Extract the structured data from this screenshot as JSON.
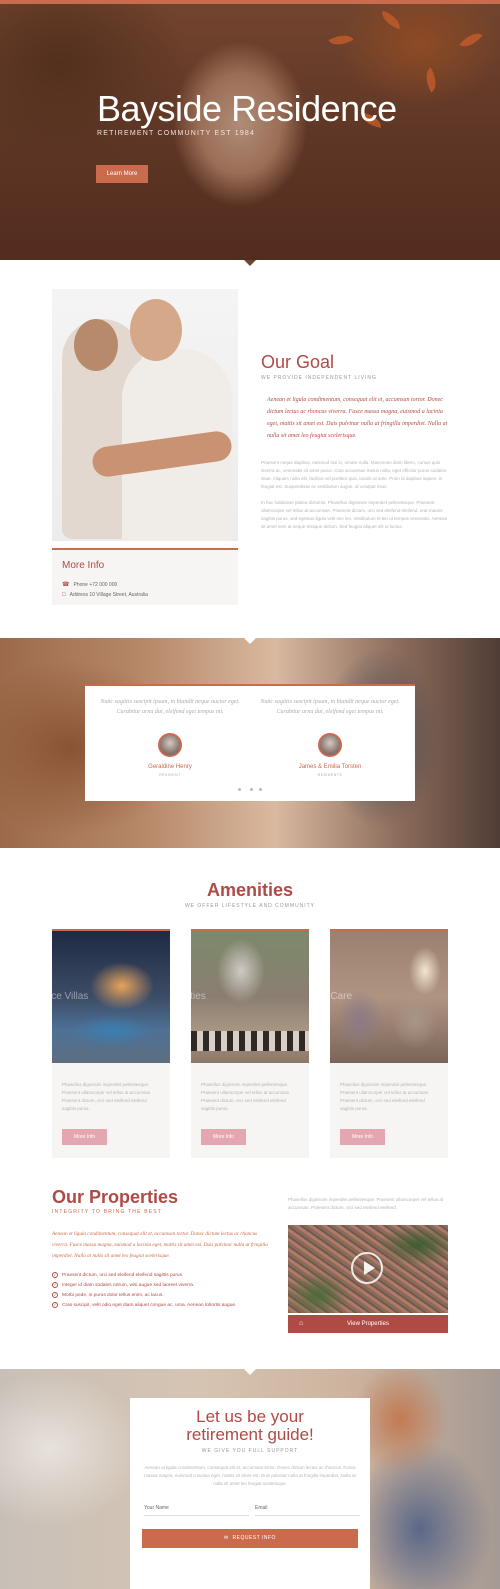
{
  "hero": {
    "title": "Bayside Residence",
    "tagline": "RETIREMENT COMMUNITY EST 1984",
    "button": "Learn More"
  },
  "goal": {
    "title": "Our Goal",
    "subtitle": "WE PROVIDE INDEPENDENT LIVING",
    "quote": "Aenean et ligula condimentum, consequat elit et, accumsan tortor. Donec dictum lectus ac rhoncus viverra. Fusce massa magna, euismod a lacinia eget, mattis sit amet est. Duis pulvinar nulla at fringilla imperdiet. Nulla at nulla sit amet leo feugiat scelerisque.",
    "paragraph1": "Praesent neque dapibus, euismod nisi in, ornare nulla. Maecenas diam libero, cursus quis viverra ac, venenatis sit amet purus. Cras accumsan metus nulla, eget efficitur purus sodales vitae. Aliquam nulla elit, facilisis vel porttitor quis, iaculis ut ante. Proin id dapibus sapien, in feugiat est. Suspendisse ac vestibulum augue, id volutpat risus.",
    "paragraph2": "In hac habitasse platea dictumst. Phasellus dignissim imperdiet pellentesque. Praesent ullamcorper vel tellus at accumsan. Praesent dictum, orci sed eleifend eleifend, erat mauris sagittis purus, sed egestas ligula velit nec leo. Vestibulum et leo ut tempus venenatis. Aenean sit amet sem at neque tristique dictum. Sed feugiat aliquet elit ut luctus."
  },
  "info": {
    "title": "More Info",
    "phone": "Phone +72 000 000",
    "address": "Address 10 Village Street, Australia"
  },
  "testimonials": [
    {
      "quote": "Nunc sagittis suscipit ipsum, in blandit neque auctor eget. Curabitur urna dui, eleifend eget tempus mi.",
      "name": "Geraldine Henry",
      "role": "RESIDENT"
    },
    {
      "quote": "Nunc sagittis suscipit ipsum, in blandit neque auctor eget. Curabitur urna dui, eleifend eget tempus mi.",
      "name": "James & Emilia Torsten",
      "role": "RESIDENTS"
    }
  ],
  "amenities": {
    "title": "Amenities",
    "subtitle": "WE OFFER LIFESTYLE AND COMMUNITY",
    "cards": [
      {
        "image_label": "vice Villas",
        "text": "Phasellus dignissim imperdiet pellentesque. Praesent ullamcorper vel tellus at accumsan. Praesent dictum, orci sed eleifend eleifend sagittis purus.",
        "button": "More Info"
      },
      {
        "image_label": "vities",
        "text": "Phasellus dignissim imperdiet pellentesque. Praesent ullamcorper vel tellus at accumsan. Praesent dictum, orci sed eleifend eleifend sagittis purus.",
        "button": "More Info"
      },
      {
        "image_label": "e Care",
        "text": "Phasellus dignissim imperdiet pellentesque. Praesent ullamcorper vel tellus at accumsan. Praesent dictum, orci sed eleifend eleifend sagittis purus.",
        "button": "More Info"
      }
    ]
  },
  "properties": {
    "title": "Our Properties",
    "subtitle": "INTEGRITY TO BRING THE BEST",
    "quote": "Aenean et ligula condimentum, consequat elit et, accumsan tortor. Donec dictum lectus ac rhoncus viverra. Fusce massa magna, euismod a lacinia eget, mattis sit amet est. Duis pulvinar nulla at fringilla imperdiet. Nulla at nulla sit amet leo feugiat scelerisque.",
    "list": [
      "Praesent dictum, orci sed eleifend eleifend sagittis purus.",
      "Integer id diam sodales rutrum, wisi augue sed laoreet viverra.",
      "Morbi pede, in purus dolor tellus enim, ac lacus.",
      "Cras suscipit, velit odio eget diam aliquet congue ac, urna. Aenean lobortis augue."
    ],
    "right_text": "Phasellus dignissim imperdiet pellentesque. Praesent ullamcorper vel tellus at accumsan. Praesent dictum, orci sed eleifend eleifend.",
    "view_button": "View Properties"
  },
  "contact": {
    "title_line1": "Let us be your",
    "title_line2": "retirement guide!",
    "subtitle": "WE GIVE YOU FULL SUPPORT",
    "text": "Aenean et ligula condimentum, consequat elit et, accumsan tortor. Donec dictum lectus ac rhoncus. Fusce massa magna, euismod a lacinia eget, mattis sit amet est. Duis pulvinar nulla at fringilla imperdiet. Nulla at nulla sit amet leo feugiat scelerisque.",
    "name_placeholder": "Your Name",
    "email_placeholder": "Email",
    "button": "REQUEST INFO"
  },
  "colors": {
    "accent": "#c96b4c",
    "brand": "#b04a45",
    "button_soft": "#e4a7b1"
  }
}
